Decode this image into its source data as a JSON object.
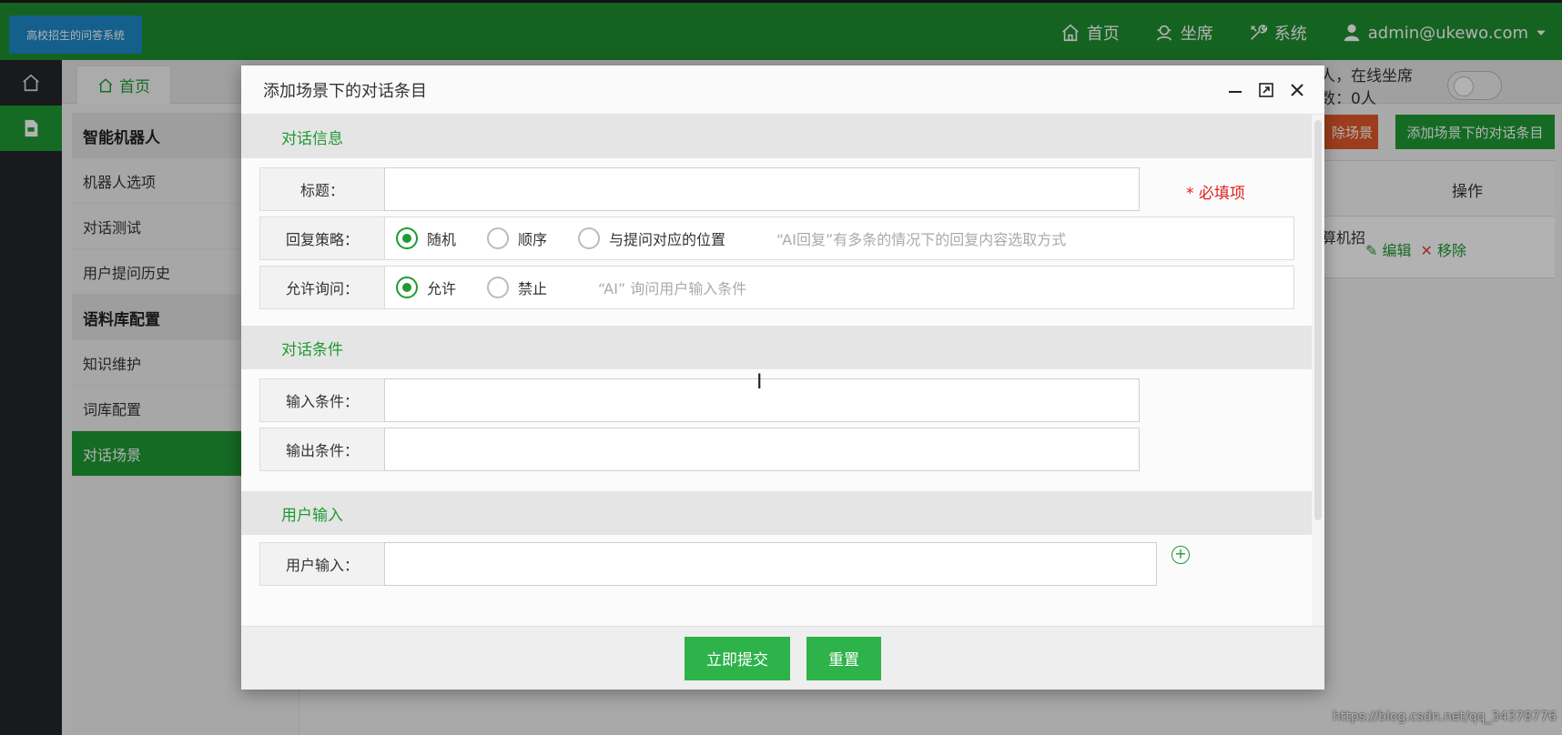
{
  "header": {
    "logo_text": "高校招生的问答系统",
    "nav": [
      {
        "label": "首页",
        "icon": "home-icon"
      },
      {
        "label": "坐席",
        "icon": "agent-icon"
      },
      {
        "label": "系统",
        "icon": "tools-icon"
      }
    ],
    "user": "admin@ukewo.com"
  },
  "background": {
    "home_tab": "首页",
    "online_status": "人，在线坐席数：0人",
    "delete_scene_button": "除场景",
    "add_item_button": "添加场景下的对话条目",
    "table_header_action": "操作",
    "table_row_text": "算机招",
    "edit_label": "编辑",
    "remove_label": "移除",
    "watermark": "https://blog.csdn.net/qq_34378776",
    "sidebar": {
      "group1": "智能机器人",
      "group1_items": [
        "机器人选项",
        "对话测试",
        "用户提问历史"
      ],
      "group2": "语料库配置",
      "group2_items": [
        "知识维护",
        "词库配置",
        "对话场景"
      ],
      "active_item": "对话场景"
    }
  },
  "modal": {
    "title": "添加场景下的对话条目",
    "section_info": "对话信息",
    "title_label": "标题：",
    "title_value": "",
    "required_hint": "* 必填项",
    "reply_strategy_label": "回复策略：",
    "reply_options": [
      "随机",
      "顺序",
      "与提问对应的位置"
    ],
    "reply_selected": "随机",
    "reply_hint": "“AI回复”有多条的情况下的回复内容选取方式",
    "allow_ask_label": "允许询问：",
    "allow_options": [
      "允许",
      "禁止"
    ],
    "allow_selected": "允许",
    "allow_hint": "“AI” 询问用户输入条件",
    "section_condition": "对话条件",
    "input_condition_label": "输入条件：",
    "output_condition_label": "输出条件：",
    "section_user_input": "用户输入",
    "user_input_label": "用户输入：",
    "submit_button": "立即提交",
    "reset_button": "重置"
  }
}
